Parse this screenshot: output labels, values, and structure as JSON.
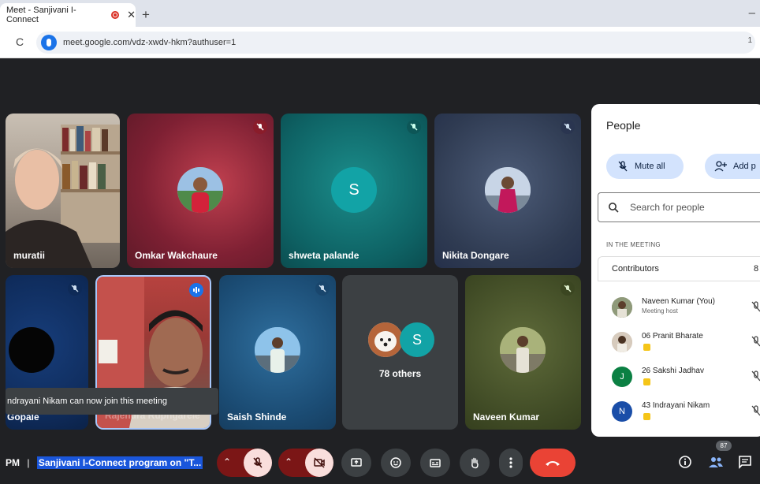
{
  "browser": {
    "tab_title": "Meet - Sanjivani I-Connect",
    "tab_close": "✕",
    "new_tab": "+",
    "minimize": "–",
    "reload": "C",
    "url": "meet.google.com/vdz-xwdv-hkm?authuser=1",
    "omnibox_right": "1"
  },
  "tiles": [
    {
      "name": "muratii"
    },
    {
      "name": "Omkar Wakchaure"
    },
    {
      "name": "shweta palande",
      "initial": "S"
    },
    {
      "name": "Nikita Dongare"
    },
    {
      "name": "Gopale"
    },
    {
      "name": "Rajendra Rupngarele"
    },
    {
      "name": "Saish Shinde"
    },
    {
      "name": "78 others",
      "initial": "S"
    },
    {
      "name": "Naveen Kumar"
    }
  ],
  "people_panel": {
    "title": "People",
    "mute_all": "Mute all",
    "add_people": "Add p",
    "search_placeholder": "Search for people",
    "section_label": "IN THE MEETING",
    "contributors_label": "Contributors",
    "contributors_count": "8",
    "people": [
      {
        "name": "Naveen Kumar (You)",
        "subtitle": "Meeting host"
      },
      {
        "name": "06 Pranit Bharate"
      },
      {
        "name": "26 Sakshi Jadhav",
        "initial": "J"
      },
      {
        "name": "43 Indrayani Nikam",
        "initial": "N"
      }
    ]
  },
  "toast": {
    "text": "ndrayani Nikam can now join this meeting"
  },
  "bottom_bar": {
    "time_fragment": "PM",
    "separator": "|",
    "meeting_title": "Sanjivani I-Connect program on \"T...",
    "participant_count": "87"
  },
  "colors": {
    "stage_bg": "#202124",
    "end_call": "#ea4335",
    "accent_blue": "#1a73e8",
    "mic_off_red": "#7b1616"
  }
}
